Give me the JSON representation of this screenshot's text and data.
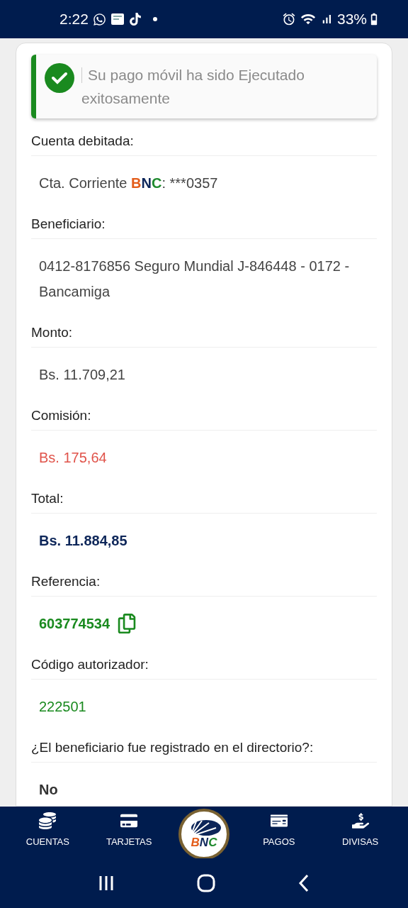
{
  "status_bar": {
    "time": "2:22",
    "battery": "33%"
  },
  "alert": {
    "message": "Su pago móvil ha sido Ejecutado exitosamente"
  },
  "rows": [
    {
      "label": "Cuenta debitada:",
      "kind": "account",
      "segments": [
        {
          "text": "Cta. Corriente "
        },
        {
          "text": "B",
          "color": "#e35d1b"
        },
        {
          "text": "N",
          "color": "#0d2659"
        },
        {
          "text": "C",
          "color": "#1f8a2e"
        },
        {
          "text": ": ***0357"
        }
      ]
    },
    {
      "label": "Beneficiario:",
      "kind": "plain",
      "value": "0412-8176856 Seguro Mundial J-846448 - 0172 - Bancamiga"
    },
    {
      "label": "Monto:",
      "kind": "plain",
      "value": "Bs. 11.709,21"
    },
    {
      "label": "Comisión:",
      "kind": "fee",
      "value": "Bs. 175,64"
    },
    {
      "label": "Total:",
      "kind": "total",
      "value": "Bs. 11.884,85"
    },
    {
      "label": "Referencia:",
      "kind": "reference",
      "value": "603774534"
    },
    {
      "label": "Código autorizador:",
      "kind": "code",
      "value": "222501"
    },
    {
      "label": "¿El beneficiario fue registrado en el directorio?:",
      "kind": "answer",
      "value": "No"
    }
  ],
  "bottom_nav": [
    {
      "kind": "tab",
      "label": "CUENTAS"
    },
    {
      "kind": "tab",
      "label": "TARJETAS"
    },
    {
      "kind": "logo",
      "letters": [
        {
          "text": "B",
          "color": "#e35d1b"
        },
        {
          "text": "N",
          "color": "#0d2659"
        },
        {
          "text": "C",
          "color": "#1f8a2e"
        }
      ]
    },
    {
      "kind": "tab",
      "label": "PAGOS"
    },
    {
      "kind": "tab",
      "label": "DIVISAS"
    }
  ]
}
